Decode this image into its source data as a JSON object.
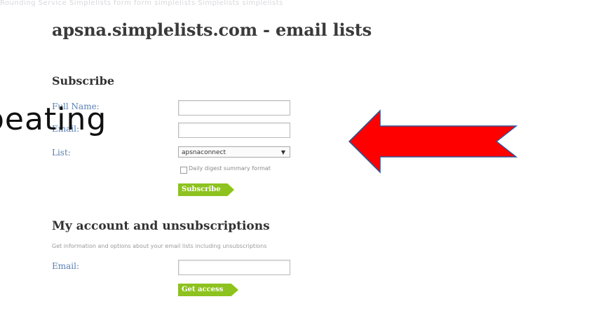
{
  "top_strip": "Rounding Service Simplelists form  form  simplelists  Simplelists simplelists",
  "page_title": "apsna.simplelists.com - email lists",
  "subscribe": {
    "heading": "Subscribe",
    "full_name_label": "Full Name:",
    "email_label": "Email:",
    "list_label": "List:",
    "list_selected": "apsnaconnect",
    "digest_label": "Daily digest summary format",
    "button": "Subscribe"
  },
  "account": {
    "heading": "My account and unsubscriptions",
    "info": "Get information and options about your email lists including unsubscriptions",
    "email_label": "Email:",
    "button": "Get access"
  },
  "overlay_text": "peating",
  "colors": {
    "accent_green": "#8dc21f",
    "label_blue": "#5a7fb5",
    "arrow_red": "#ff0000",
    "arrow_border": "#2f5597"
  }
}
